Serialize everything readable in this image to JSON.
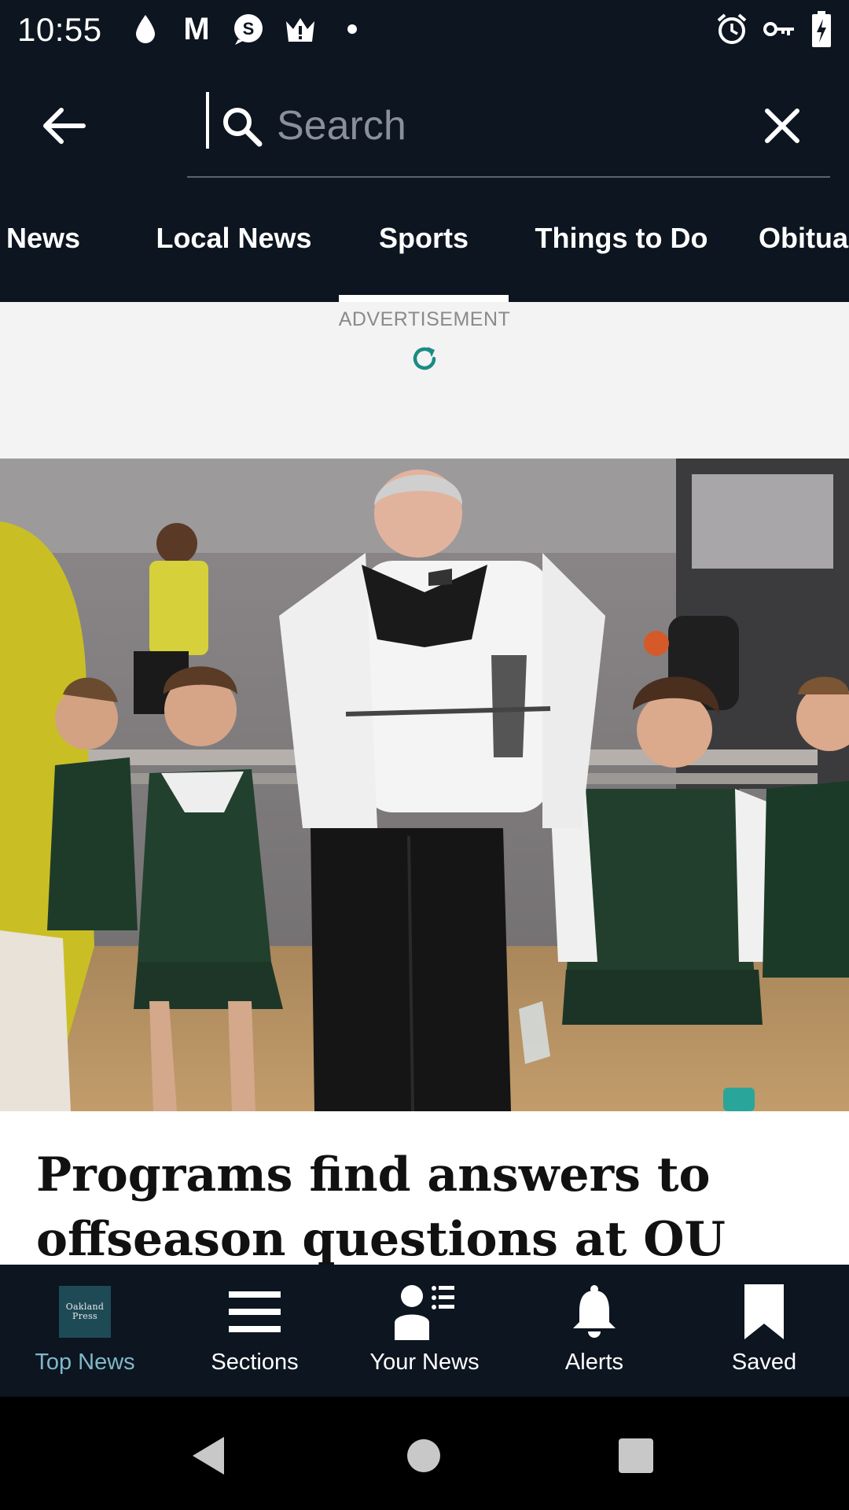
{
  "status_bar": {
    "time": "10:55",
    "left_icons": [
      "drop-icon",
      "gmail-icon",
      "s-notification-icon",
      "crown-alert-icon",
      "dot-icon"
    ],
    "right_icons": [
      "alarm-icon",
      "vpn-key-icon",
      "battery-charging-icon"
    ],
    "gmail_letter": "M",
    "s_letter": "S"
  },
  "search": {
    "placeholder": "Search",
    "value": ""
  },
  "tabs": {
    "items": [
      {
        "label": "News"
      },
      {
        "label": "Local News"
      },
      {
        "label": "Sports"
      },
      {
        "label": "Things to Do"
      },
      {
        "label": "Obitua"
      }
    ],
    "selected": "Sports"
  },
  "ad": {
    "label": "ADVERTISEMENT"
  },
  "article": {
    "headline": "Programs find answers to offseason questions at OU team"
  },
  "bottom_nav": {
    "items": [
      {
        "label": "Top News",
        "active": true,
        "logo_line1": "Oakland",
        "logo_line2": "Press"
      },
      {
        "label": "Sections"
      },
      {
        "label": "Your News"
      },
      {
        "label": "Alerts"
      },
      {
        "label": "Saved"
      }
    ],
    "active_color": "#7fb8c9"
  },
  "colors": {
    "app_bar": "#0c1520",
    "accent_teal": "#1a8c83"
  }
}
